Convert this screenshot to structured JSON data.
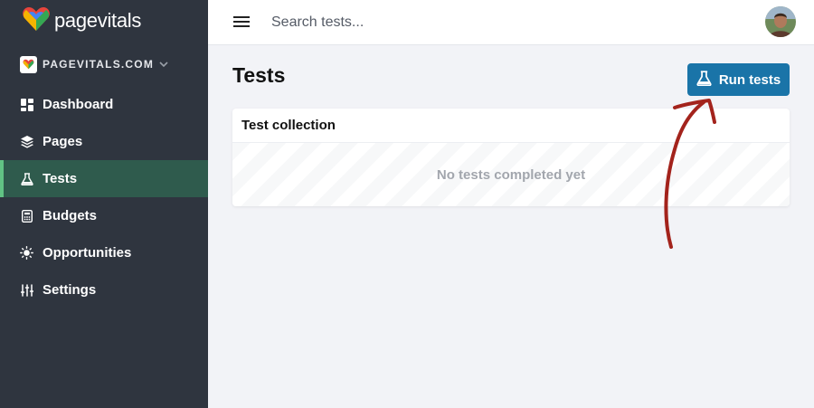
{
  "brand": {
    "name": "pagevitals"
  },
  "site_selector": {
    "name": "PAGEVITALS.COM"
  },
  "sidebar": {
    "items": [
      {
        "label": "Dashboard",
        "icon": "dashboard-icon",
        "active": false
      },
      {
        "label": "Pages",
        "icon": "layers-icon",
        "active": false
      },
      {
        "label": "Tests",
        "icon": "flask-icon",
        "active": true
      },
      {
        "label": "Budgets",
        "icon": "calculator-icon",
        "active": false
      },
      {
        "label": "Opportunities",
        "icon": "lightbulb-icon",
        "active": false
      },
      {
        "label": "Settings",
        "icon": "sliders-icon",
        "active": false
      }
    ]
  },
  "header": {
    "search_placeholder": "Search tests..."
  },
  "main": {
    "title": "Tests",
    "run_button_label": "Run tests",
    "card": {
      "title": "Test collection",
      "empty_message": "No tests completed yet"
    }
  },
  "colors": {
    "sidebar_bg": "#2f353f",
    "active_bg": "#2f5b4d",
    "active_accent": "#61c384",
    "primary_button": "#1a74a8",
    "annotation_arrow": "#a3231c"
  }
}
